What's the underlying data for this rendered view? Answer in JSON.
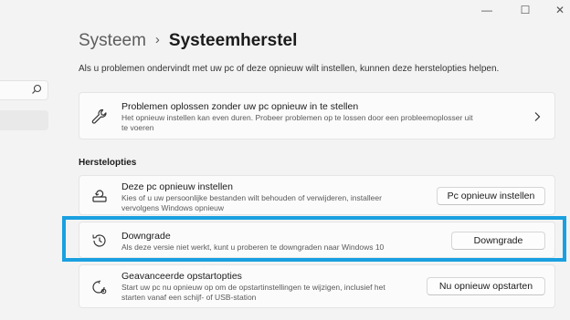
{
  "window": {
    "minimize_glyph": "—",
    "maximize_glyph": "☐",
    "close_glyph": "✕"
  },
  "breadcrumb": {
    "parent": "Systeem",
    "separator": "›",
    "current": "Systeemherstel"
  },
  "intro": "Als u problemen ondervindt met uw pc of deze opnieuw wilt instellen, kunnen deze herstelopties helpen.",
  "troubleshoot": {
    "icon": "wrench-icon",
    "title": "Problemen oplossen zonder uw pc opnieuw in te stellen",
    "desc": "Het opnieuw instellen kan even duren. Probeer problemen op te lossen door een probleemoplosser uit te voeren"
  },
  "section_title": "Herstelopties",
  "options": [
    {
      "icon": "reset-pc-icon",
      "title": "Deze pc opnieuw instellen",
      "desc": "Kies of u uw persoonlijke bestanden wilt behouden of verwijderen, installeer vervolgens Windows opnieuw",
      "button": "Pc opnieuw instellen"
    },
    {
      "icon": "history-icon",
      "title": "Downgrade",
      "desc": "Als deze versie niet werkt, kunt u proberen te downgraden naar Windows 10",
      "button": "Downgrade"
    },
    {
      "icon": "advanced-startup-icon",
      "title": "Geavanceerde opstartopties",
      "desc": "Start uw pc nu opnieuw op om de opstartinstellingen te wijzigen, inclusief het starten vanaf een schijf- of USB-station",
      "button": "Nu opnieuw opstarten"
    }
  ],
  "colors": {
    "background": "#f3f3f3",
    "card": "#fbfbfb",
    "highlight": "#1aa0e0"
  }
}
